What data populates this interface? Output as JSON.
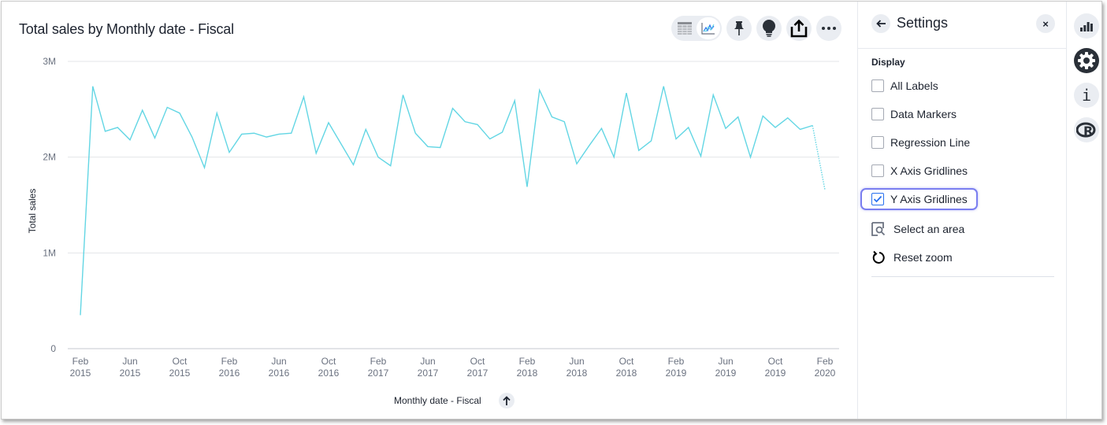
{
  "chart_header": {
    "title": "Total sales by Monthly date - Fiscal"
  },
  "toolbar": {
    "buttons": [
      {
        "name": "table-view",
        "icon": "table-icon"
      },
      {
        "name": "chart-view",
        "icon": "line-chart-icon",
        "active": true
      },
      {
        "name": "pin",
        "icon": "pin-icon"
      },
      {
        "name": "spotiq",
        "icon": "lightbulb-icon"
      },
      {
        "name": "share",
        "icon": "share-icon"
      },
      {
        "name": "more",
        "icon": "more-icon"
      }
    ]
  },
  "settings": {
    "title": "Settings",
    "close_label": "×",
    "section": "Display",
    "options": [
      {
        "label": "All Labels",
        "checked": false
      },
      {
        "label": "Data Markers",
        "checked": false
      },
      {
        "label": "Regression Line",
        "checked": false
      },
      {
        "label": "X Axis Gridlines",
        "checked": false
      },
      {
        "label": "Y Axis Gridlines",
        "checked": true
      }
    ],
    "actions": [
      {
        "label": "Select an area",
        "icon": "select-area-icon"
      },
      {
        "label": "Reset zoom",
        "icon": "reset-icon"
      }
    ]
  },
  "rail": {
    "items": [
      {
        "name": "chart-type",
        "icon": "bar-chart-icon"
      },
      {
        "name": "settings",
        "icon": "gear-icon",
        "active": true
      },
      {
        "name": "info",
        "icon": "info-icon",
        "glyph": "i"
      },
      {
        "name": "r-analysis",
        "icon": "r-icon",
        "glyph": "R"
      }
    ]
  },
  "colors": {
    "series": "#63d6e4",
    "gridline": "#e3e5e8",
    "text": "#1d232f",
    "tick": "#6b7280",
    "focus": "#7a7ef0",
    "checkbox_checked": "#2770ef"
  },
  "chart_data": {
    "type": "line",
    "title": "Total sales by Monthly date - Fiscal",
    "xlabel": "Monthly date - Fiscal",
    "ylabel": "Total sales",
    "ylim": [
      0,
      3000000
    ],
    "yticks": [
      {
        "value": 0,
        "label": "0"
      },
      {
        "value": 1000000,
        "label": "1M"
      },
      {
        "value": 2000000,
        "label": "2M"
      },
      {
        "value": 3000000,
        "label": "3M"
      }
    ],
    "xticks": [
      {
        "index": 0,
        "line1": "Feb",
        "line2": "2015"
      },
      {
        "index": 4,
        "line1": "Jun",
        "line2": "2015"
      },
      {
        "index": 8,
        "line1": "Oct",
        "line2": "2015"
      },
      {
        "index": 12,
        "line1": "Feb",
        "line2": "2016"
      },
      {
        "index": 16,
        "line1": "Jun",
        "line2": "2016"
      },
      {
        "index": 20,
        "line1": "Oct",
        "line2": "2016"
      },
      {
        "index": 24,
        "line1": "Feb",
        "line2": "2017"
      },
      {
        "index": 28,
        "line1": "Jun",
        "line2": "2017"
      },
      {
        "index": 32,
        "line1": "Oct",
        "line2": "2017"
      },
      {
        "index": 36,
        "line1": "Feb",
        "line2": "2018"
      },
      {
        "index": 40,
        "line1": "Jun",
        "line2": "2018"
      },
      {
        "index": 44,
        "line1": "Oct",
        "line2": "2018"
      },
      {
        "index": 48,
        "line1": "Feb",
        "line2": "2019"
      },
      {
        "index": 52,
        "line1": "Jun",
        "line2": "2019"
      },
      {
        "index": 56,
        "line1": "Oct",
        "line2": "2019"
      },
      {
        "index": 60,
        "line1": "Feb",
        "line2": "2020"
      }
    ],
    "grid": {
      "x": false,
      "y": true
    },
    "sort": "ascending",
    "series": [
      {
        "name": "Total sales",
        "x": [
          "2015-02",
          "2015-03",
          "2015-04",
          "2015-05",
          "2015-06",
          "2015-07",
          "2015-08",
          "2015-09",
          "2015-10",
          "2015-11",
          "2015-12",
          "2016-01",
          "2016-02",
          "2016-03",
          "2016-04",
          "2016-05",
          "2016-06",
          "2016-07",
          "2016-08",
          "2016-09",
          "2016-10",
          "2016-11",
          "2016-12",
          "2017-01",
          "2017-02",
          "2017-03",
          "2017-04",
          "2017-05",
          "2017-06",
          "2017-07",
          "2017-08",
          "2017-09",
          "2017-10",
          "2017-11",
          "2017-12",
          "2018-01",
          "2018-02",
          "2018-03",
          "2018-04",
          "2018-05",
          "2018-06",
          "2018-07",
          "2018-08",
          "2018-09",
          "2018-10",
          "2018-11",
          "2018-12",
          "2019-01",
          "2019-02",
          "2019-03",
          "2019-04",
          "2019-05",
          "2019-06",
          "2019-07",
          "2019-08",
          "2019-09",
          "2019-10",
          "2019-11",
          "2019-12",
          "2020-01",
          "2020-02"
        ],
        "values": [
          350000,
          2740000,
          2270000,
          2310000,
          2180000,
          2490000,
          2200000,
          2520000,
          2460000,
          2210000,
          1890000,
          2460000,
          2050000,
          2240000,
          2250000,
          2210000,
          2240000,
          2250000,
          2630000,
          2040000,
          2360000,
          2140000,
          1920000,
          2290000,
          2000000,
          1910000,
          2650000,
          2250000,
          2110000,
          2100000,
          2510000,
          2370000,
          2340000,
          2190000,
          2260000,
          2590000,
          1690000,
          2700000,
          2420000,
          2370000,
          1930000,
          2120000,
          2300000,
          2000000,
          2670000,
          2070000,
          2170000,
          2740000,
          2190000,
          2310000,
          2010000,
          2650000,
          2300000,
          2420000,
          2000000,
          2430000,
          2310000,
          2410000,
          2290000,
          2330000,
          1660000
        ],
        "partial_last_point": true
      }
    ]
  },
  "x_axis": {
    "title": "Monthly date - Fiscal",
    "sort_icon": "arrow-up-icon"
  }
}
